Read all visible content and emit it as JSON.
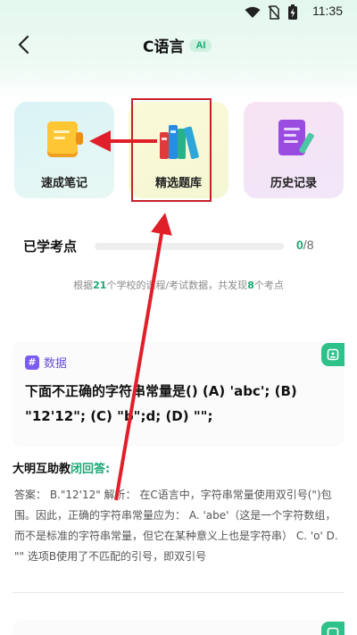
{
  "status_bar": {
    "time": "11:35",
    "icons": [
      "wifi-icon",
      "no-sim-icon",
      "battery-charging-icon"
    ]
  },
  "nav": {
    "title": "C语言",
    "badge": "AI"
  },
  "features": [
    {
      "label": "速成笔记",
      "icon": "notebook-icon"
    },
    {
      "label": "精选题库",
      "icon": "books-icon"
    },
    {
      "label": "历史记录",
      "icon": "document-pen-icon"
    }
  ],
  "progress": {
    "label": "已学考点",
    "done": "0",
    "separator": "/",
    "total": "8",
    "fraction": 0
  },
  "info_line": {
    "prefix": "根据",
    "schools": "21",
    "middle": "个学校的课程/考试数据，共发现",
    "points": "8",
    "suffix": "个考点"
  },
  "question": {
    "tag": "数据",
    "tag_icon": "#",
    "text": "下面不正确的字符串常量是() (A) 'abc'; (B) \"12'12\"; (C) \"b\";d; (D) \"\";"
  },
  "answer": {
    "title_prefix": "大明互助教",
    "title_link": "闭回答:",
    "text": "答案： B.\"12'12\" 解析： 在C语言中，字符串常量使用双引号(\")包围。因此，正确的字符串常量应为： A. 'abe'（这是一个字符数组，而不是标准的字符串常量，但它在某种意义上也是字符串） C. 'o' D. \"\" 选项B使用了不匹配的引号，即双引号"
  },
  "colors": {
    "accent": "#1aa872",
    "highlight": "#c8202a",
    "tag": "#7c5cf0"
  }
}
